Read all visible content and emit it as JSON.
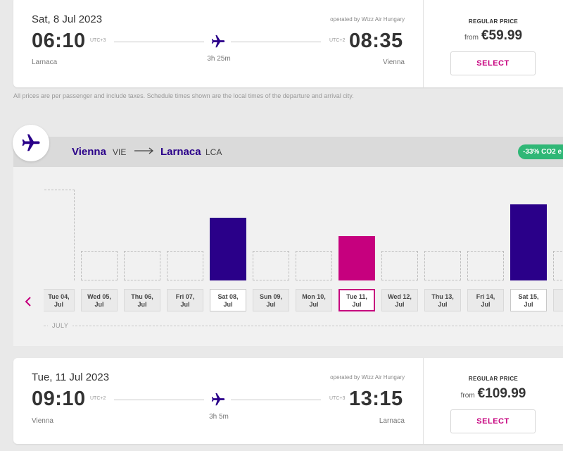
{
  "outbound": {
    "date": "Sat, 8 Jul 2023",
    "operated_by": "operated by Wizz Air Hungary",
    "depart_time": "06:10",
    "depart_utc": "UTC+3",
    "depart_city": "Larnaca",
    "arrive_time": "08:35",
    "arrive_utc": "UTC+2",
    "arrive_city": "Vienna",
    "duration": "3h 25m",
    "price_label": "REGULAR PRICE",
    "price_from": "from",
    "price": "€59.99",
    "select_label": "SELECT"
  },
  "disclaimer": "All prices are per passenger and include taxes. Schedule times shown are the local times of the departure and arrival city.",
  "route": {
    "origin_city": "Vienna",
    "origin_code": "VIE",
    "dest_city": "Larnaca",
    "dest_code": "LCA",
    "co2_badge": "-33% CO2 e"
  },
  "calendar": {
    "month": "JULY",
    "days": [
      {
        "line1": "Tue 04,",
        "line2": "Jul",
        "state": "empty",
        "fare": null
      },
      {
        "line1": "Wed 05,",
        "line2": "Jul",
        "state": "empty",
        "fare": null
      },
      {
        "line1": "Thu 06,",
        "line2": "Jul",
        "state": "empty",
        "fare": null
      },
      {
        "line1": "Fri 07,",
        "line2": "Jul",
        "state": "empty",
        "fare": null
      },
      {
        "line1": "Sat 08,",
        "line2": "Jul",
        "state": "available",
        "fare": 0.59
      },
      {
        "line1": "Sun 09,",
        "line2": "Jul",
        "state": "empty",
        "fare": null
      },
      {
        "line1": "Mon 10,",
        "line2": "Jul",
        "state": "empty",
        "fare": null
      },
      {
        "line1": "Tue 11,",
        "line2": "Jul",
        "state": "selected",
        "fare": 0.42
      },
      {
        "line1": "Wed 12,",
        "line2": "Jul",
        "state": "empty",
        "fare": null
      },
      {
        "line1": "Thu 13,",
        "line2": "Jul",
        "state": "empty",
        "fare": null
      },
      {
        "line1": "Fri 14,",
        "line2": "Jul",
        "state": "empty",
        "fare": null
      },
      {
        "line1": "Sat 15,",
        "line2": "Jul",
        "state": "available",
        "fare": 0.72
      },
      {
        "line1": "S",
        "line2": "",
        "state": "empty",
        "fare": null
      }
    ]
  },
  "return": {
    "date": "Tue, 11 Jul 2023",
    "operated_by": "operated by Wizz Air Hungary",
    "depart_time": "09:10",
    "depart_utc": "UTC+2",
    "depart_city": "Vienna",
    "arrive_time": "13:15",
    "arrive_utc": "UTC+3",
    "arrive_city": "Larnaca",
    "duration": "3h 5m",
    "price_label": "REGULAR PRICE",
    "price_from": "from",
    "price": "€109.99",
    "select_label": "SELECT"
  },
  "colors": {
    "brand_purple": "#2a0089",
    "brand_magenta": "#c6007e",
    "co2_green": "#2fb776"
  },
  "icons": [
    "airplane-icon",
    "arrow-right-icon",
    "chevron-left-icon"
  ]
}
